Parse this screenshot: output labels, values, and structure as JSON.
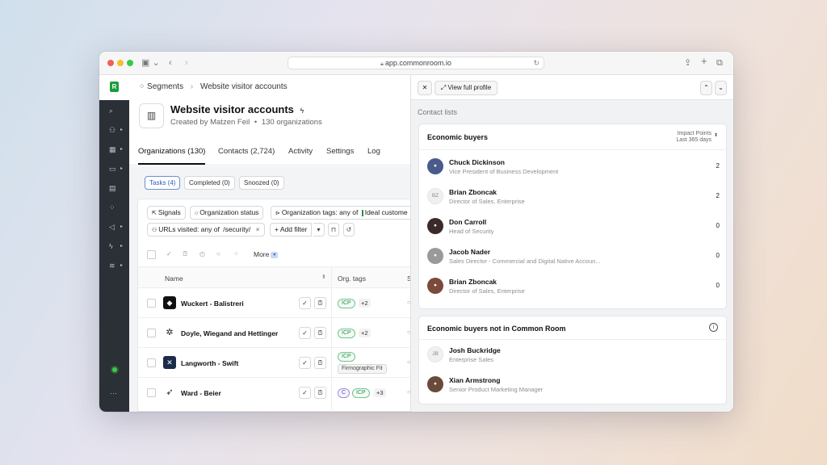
{
  "browser": {
    "url": "app.commonroom.io",
    "traffic_lights": [
      "#f25f58",
      "#f9bd2e",
      "#3ac94a"
    ]
  },
  "app": {
    "logo_text": "R",
    "brand_color": "#1d9b3f"
  },
  "sidebar": {
    "items": [
      {
        "icon": "search-icon",
        "glyph": "⌕"
      },
      {
        "icon": "people-icon",
        "glyph": "⚇"
      },
      {
        "icon": "building-icon",
        "glyph": "▦"
      },
      {
        "icon": "chat-icon",
        "glyph": "▭"
      },
      {
        "icon": "table-icon",
        "glyph": "▤"
      },
      {
        "icon": "grid-icon",
        "glyph": "⁘"
      },
      {
        "icon": "megaphone-icon",
        "glyph": "◁"
      },
      {
        "icon": "bolt-icon",
        "glyph": "ϟ"
      },
      {
        "icon": "chart-icon",
        "glyph": "≋"
      }
    ],
    "more": "···"
  },
  "breadcrumb": {
    "parent": "Segments",
    "current": "Website visitor accounts"
  },
  "header": {
    "title": "Website visitor accounts",
    "subtitle_creator": "Created by Matzen Feil",
    "subtitle_count": "130 organizations"
  },
  "tabs": [
    "Organizations (130)",
    "Contacts (2,724)",
    "Activity",
    "Settings",
    "Log"
  ],
  "subtabs": [
    "Tasks (4)",
    "Completed (0)",
    "Snoozed (0)"
  ],
  "filters": {
    "signals": "Signals",
    "org_status": "Organization status",
    "org_tags_prefix": "Organization tags: any of",
    "org_tags_value": "Ideal custome",
    "urls_prefix": "URLs visited: any of",
    "urls_value": "/security/",
    "add_filter": "+ Add filter"
  },
  "bulk": {
    "more": "More"
  },
  "table": {
    "columns": [
      "Name",
      "Org. tags",
      "S"
    ],
    "rows": [
      {
        "name": "Wuckert - Balistreri",
        "tags": [
          "ICP"
        ],
        "extra": "+2"
      },
      {
        "name": "Doyle, Wiegand and Hettinger",
        "tags": [
          "ICP"
        ],
        "extra": "+2"
      },
      {
        "name": "Langworth - Swift",
        "tags": [
          "ICP",
          "Firmographic Fit"
        ],
        "extra": ""
      },
      {
        "name": "Ward - Beier",
        "tags": [
          "C",
          "ICP"
        ],
        "extra": "+3"
      }
    ]
  },
  "drawer": {
    "view_full_profile": "View full profile",
    "section": "Contact lists",
    "economic_buyers": {
      "title": "Economic buyers",
      "sort_label": "Impact Points",
      "sort_sub": "Last 365 days",
      "people": [
        {
          "name": "Chuck Dickinson",
          "title": "Vice President of Business Development",
          "count": "2",
          "initials": "",
          "color": "#4a5a8a"
        },
        {
          "name": "Brian Zboncak",
          "title": "Director of Sales, Enterprise",
          "count": "2",
          "initials": "BZ",
          "color": ""
        },
        {
          "name": "Don Carroll",
          "title": "Head of Security",
          "count": "0",
          "initials": "",
          "color": "#3a2a2a"
        },
        {
          "name": "Jacob Nader",
          "title": "Sales Director - Commercial and Digital Native Accoun...",
          "count": "0",
          "initials": "",
          "color": "#9a9a9a"
        },
        {
          "name": "Brian Zboncak",
          "title": "Director of Sales, Enterprise",
          "count": "0",
          "initials": "",
          "color": "#7a4a3a"
        }
      ]
    },
    "not_in_cr": {
      "title": "Economic buyers not in Common Room",
      "people": [
        {
          "name": "Josh Buckridge",
          "title": "Enterprise Sales",
          "initials": "JB",
          "color": ""
        },
        {
          "name": "Xian Armstrong",
          "title": "Senior Product Marketing Manager",
          "initials": "",
          "color": "#6a4a3a"
        }
      ]
    }
  }
}
